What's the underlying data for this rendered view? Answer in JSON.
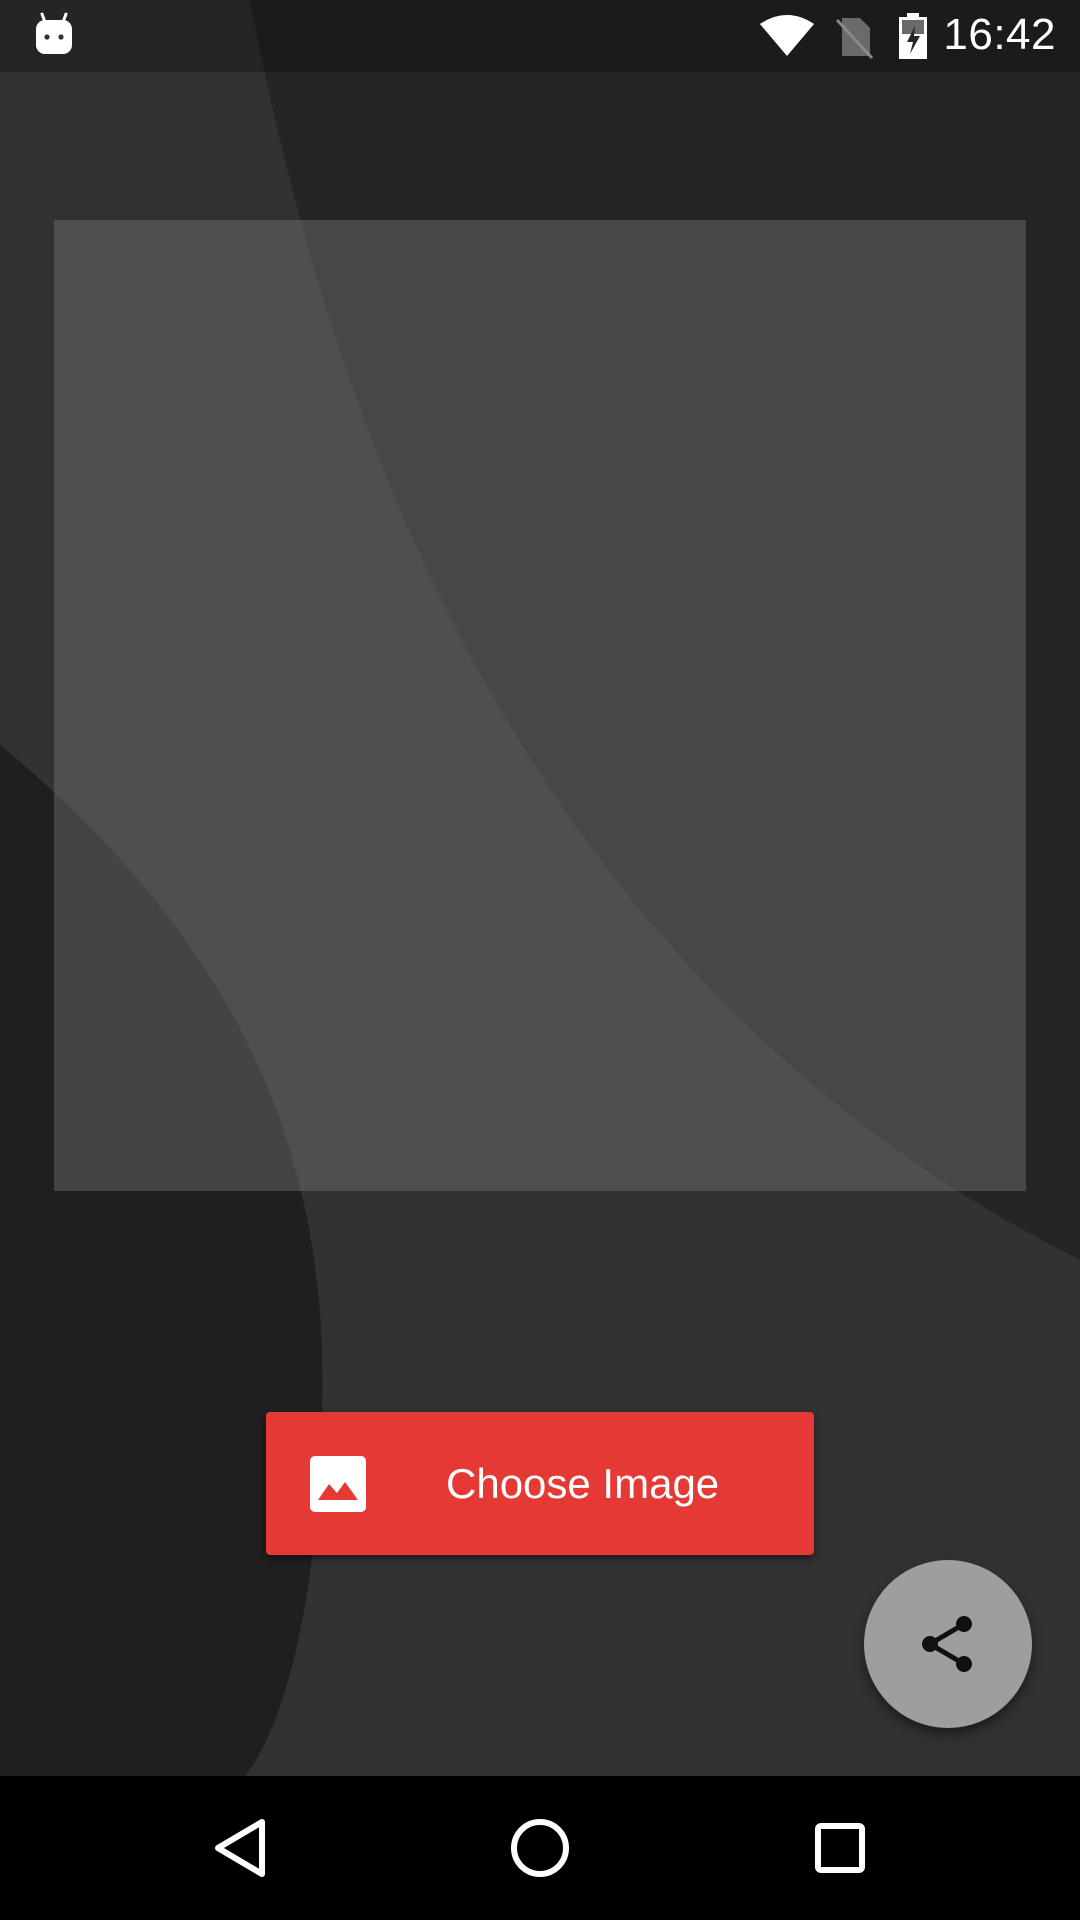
{
  "status_bar": {
    "time": "16:42",
    "icons": [
      "android-notification-icon",
      "wifi-icon",
      "no-sim-icon",
      "battery-charging-icon"
    ]
  },
  "preview": {
    "placeholder_color": "#5a5a5a"
  },
  "choose_button": {
    "label": "Choose Image",
    "icon": "image-icon",
    "color": "#e53935"
  },
  "share_fab": {
    "icon": "share-icon",
    "color": "#9e9e9e"
  },
  "nav_bar": {
    "buttons": [
      "back-icon",
      "home-icon",
      "recents-icon"
    ]
  }
}
